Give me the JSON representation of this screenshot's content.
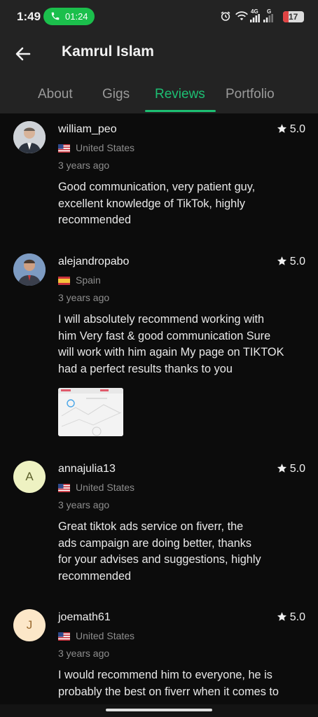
{
  "status_bar": {
    "time": "1:49",
    "call_timer": "01:24",
    "network_label_1": "4G",
    "network_label_2": "G",
    "battery": "17",
    "icons": [
      "alarm-icon",
      "wifi-icon",
      "signal-icon",
      "battery-icon"
    ]
  },
  "header": {
    "back_icon": "arrow-left-icon",
    "title": "Kamrul Islam"
  },
  "tabs": [
    {
      "label": "About",
      "active": false
    },
    {
      "label": "Gigs",
      "active": false
    },
    {
      "label": "Reviews",
      "active": true
    },
    {
      "label": "Portfolio",
      "active": false
    }
  ],
  "colors": {
    "accent": "#1dbf73",
    "call_pill": "#1bbf4c",
    "header_bg": "#232323",
    "content_bg": "#0c0c0c"
  },
  "reviews": [
    {
      "username": "william_peo",
      "rating": "5.0",
      "country": "United States",
      "flag": "us-flag-icon",
      "time": "3 years ago",
      "lines": [
        "Good communication, very patient guy,",
        "excellent knowledge of TikTok, highly",
        "recommended"
      ]
    },
    {
      "username": "alejandropabo",
      "rating": "5.0",
      "country": "Spain",
      "flag": "spain-flag-icon",
      "time": "3 years ago",
      "lines": [
        "I will absolutely recommend working with",
        "him Very fast & good communication Sure",
        "will work with him again My page on TIKTOK",
        "had a perfect results thanks to you"
      ]
    },
    {
      "username": "annajulia13",
      "avatar_letter": "A",
      "rating": "5.0",
      "country": "United States",
      "flag": "us-flag-icon",
      "time": "3 years ago",
      "lines": [
        "Great tiktok ads service on fiverr, the",
        "ads campaign are doing better, thanks",
        "for your advises and suggestions, highly",
        "recommended"
      ]
    },
    {
      "username": "joemath61",
      "avatar_letter": "J",
      "rating": "5.0",
      "country": "United States",
      "flag": "us-flag-icon",
      "time": "3 years ago",
      "lines": [
        "I would recommend him to everyone, he is",
        "probably the best on fiverr when it comes to"
      ]
    }
  ]
}
